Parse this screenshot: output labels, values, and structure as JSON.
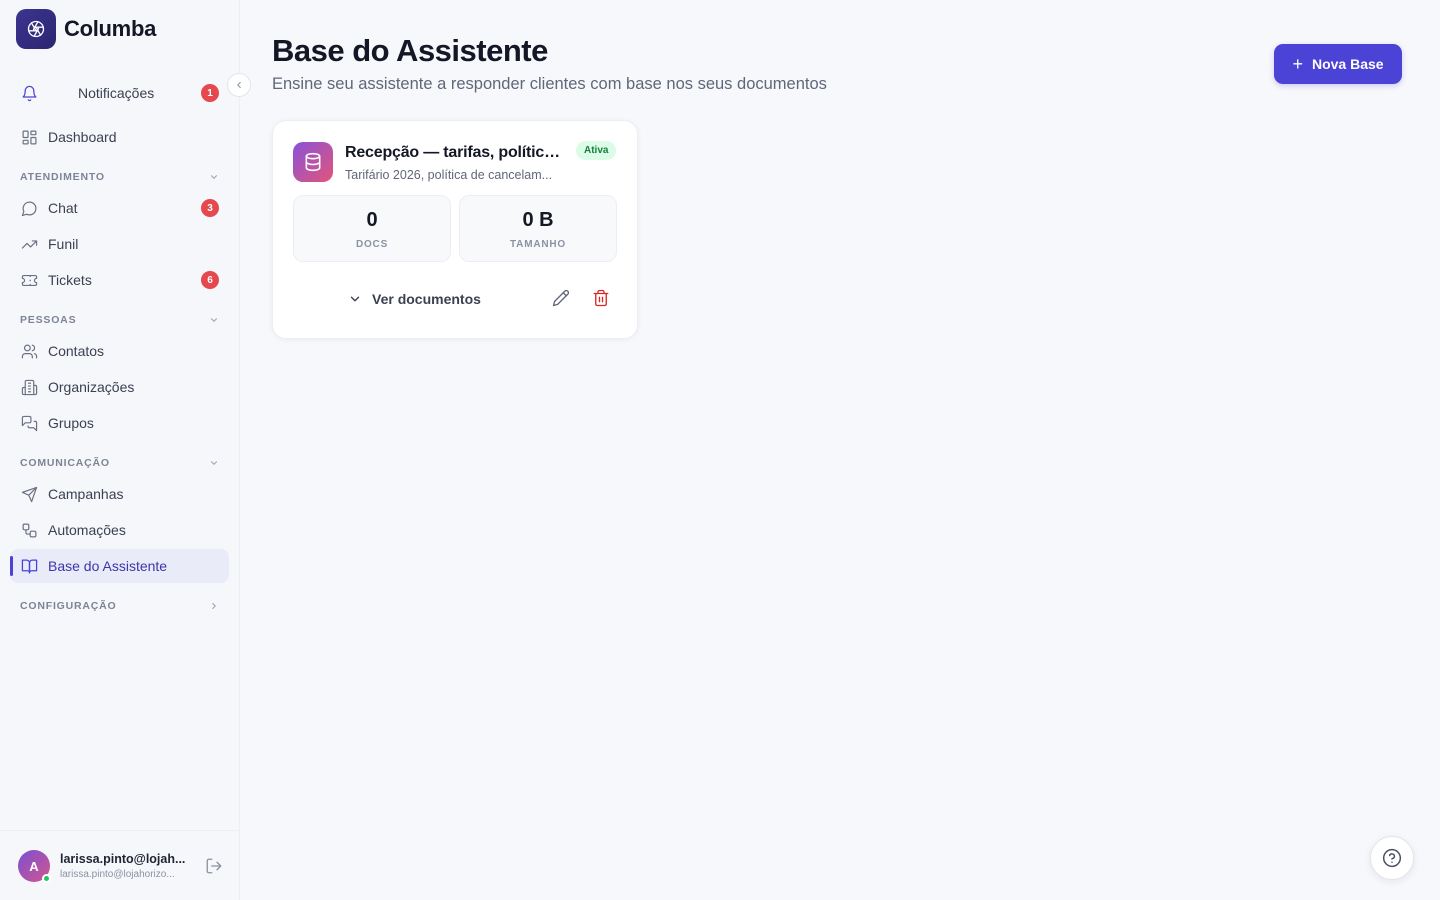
{
  "brand": {
    "name": "Columba",
    "logo_icon": "aperture-icon"
  },
  "sidebar": {
    "notifications": {
      "label": "Notificações",
      "count": "1"
    },
    "dashboard": {
      "label": "Dashboard"
    },
    "sections": {
      "atendimento": {
        "title": "ATENDIMENTO",
        "items": [
          {
            "label": "Chat",
            "badge": "3"
          },
          {
            "label": "Funil"
          },
          {
            "label": "Tickets",
            "badge": "6"
          }
        ]
      },
      "pessoas": {
        "title": "PESSOAS",
        "items": [
          {
            "label": "Contatos"
          },
          {
            "label": "Organizações"
          },
          {
            "label": "Grupos"
          }
        ]
      },
      "comunicacao": {
        "title": "COMUNICAÇÃO",
        "items": [
          {
            "label": "Campanhas"
          },
          {
            "label": "Automações"
          },
          {
            "label": "Base do Assistente",
            "active": true
          }
        ]
      },
      "configuracao": {
        "title": "CONFIGURAÇÃO"
      }
    },
    "user": {
      "initial": "A",
      "name": "larissa.pinto@lojah...",
      "email": "larissa.pinto@lojahorizo...",
      "status_color": "#22c55e"
    }
  },
  "page": {
    "title": "Base do Assistente",
    "subtitle": "Ensine seu assistente a responder clientes com base nos seus documentos",
    "new_button_label": "Nova Base"
  },
  "knowledge_bases": [
    {
      "title": "Recepção — tarifas, política...",
      "description": "Tarifário 2026, política de cancelam...",
      "status": "Ativa",
      "docs_count": "0",
      "docs_label": "DOCS",
      "size": "0 B",
      "size_label": "TAMANHO",
      "toggle_label": "Ver documentos"
    }
  ],
  "colors": {
    "accent": "#4b42d6",
    "badge_red": "#e5484d",
    "active_bg": "#e9ebf8",
    "status_green": "#15803d"
  }
}
